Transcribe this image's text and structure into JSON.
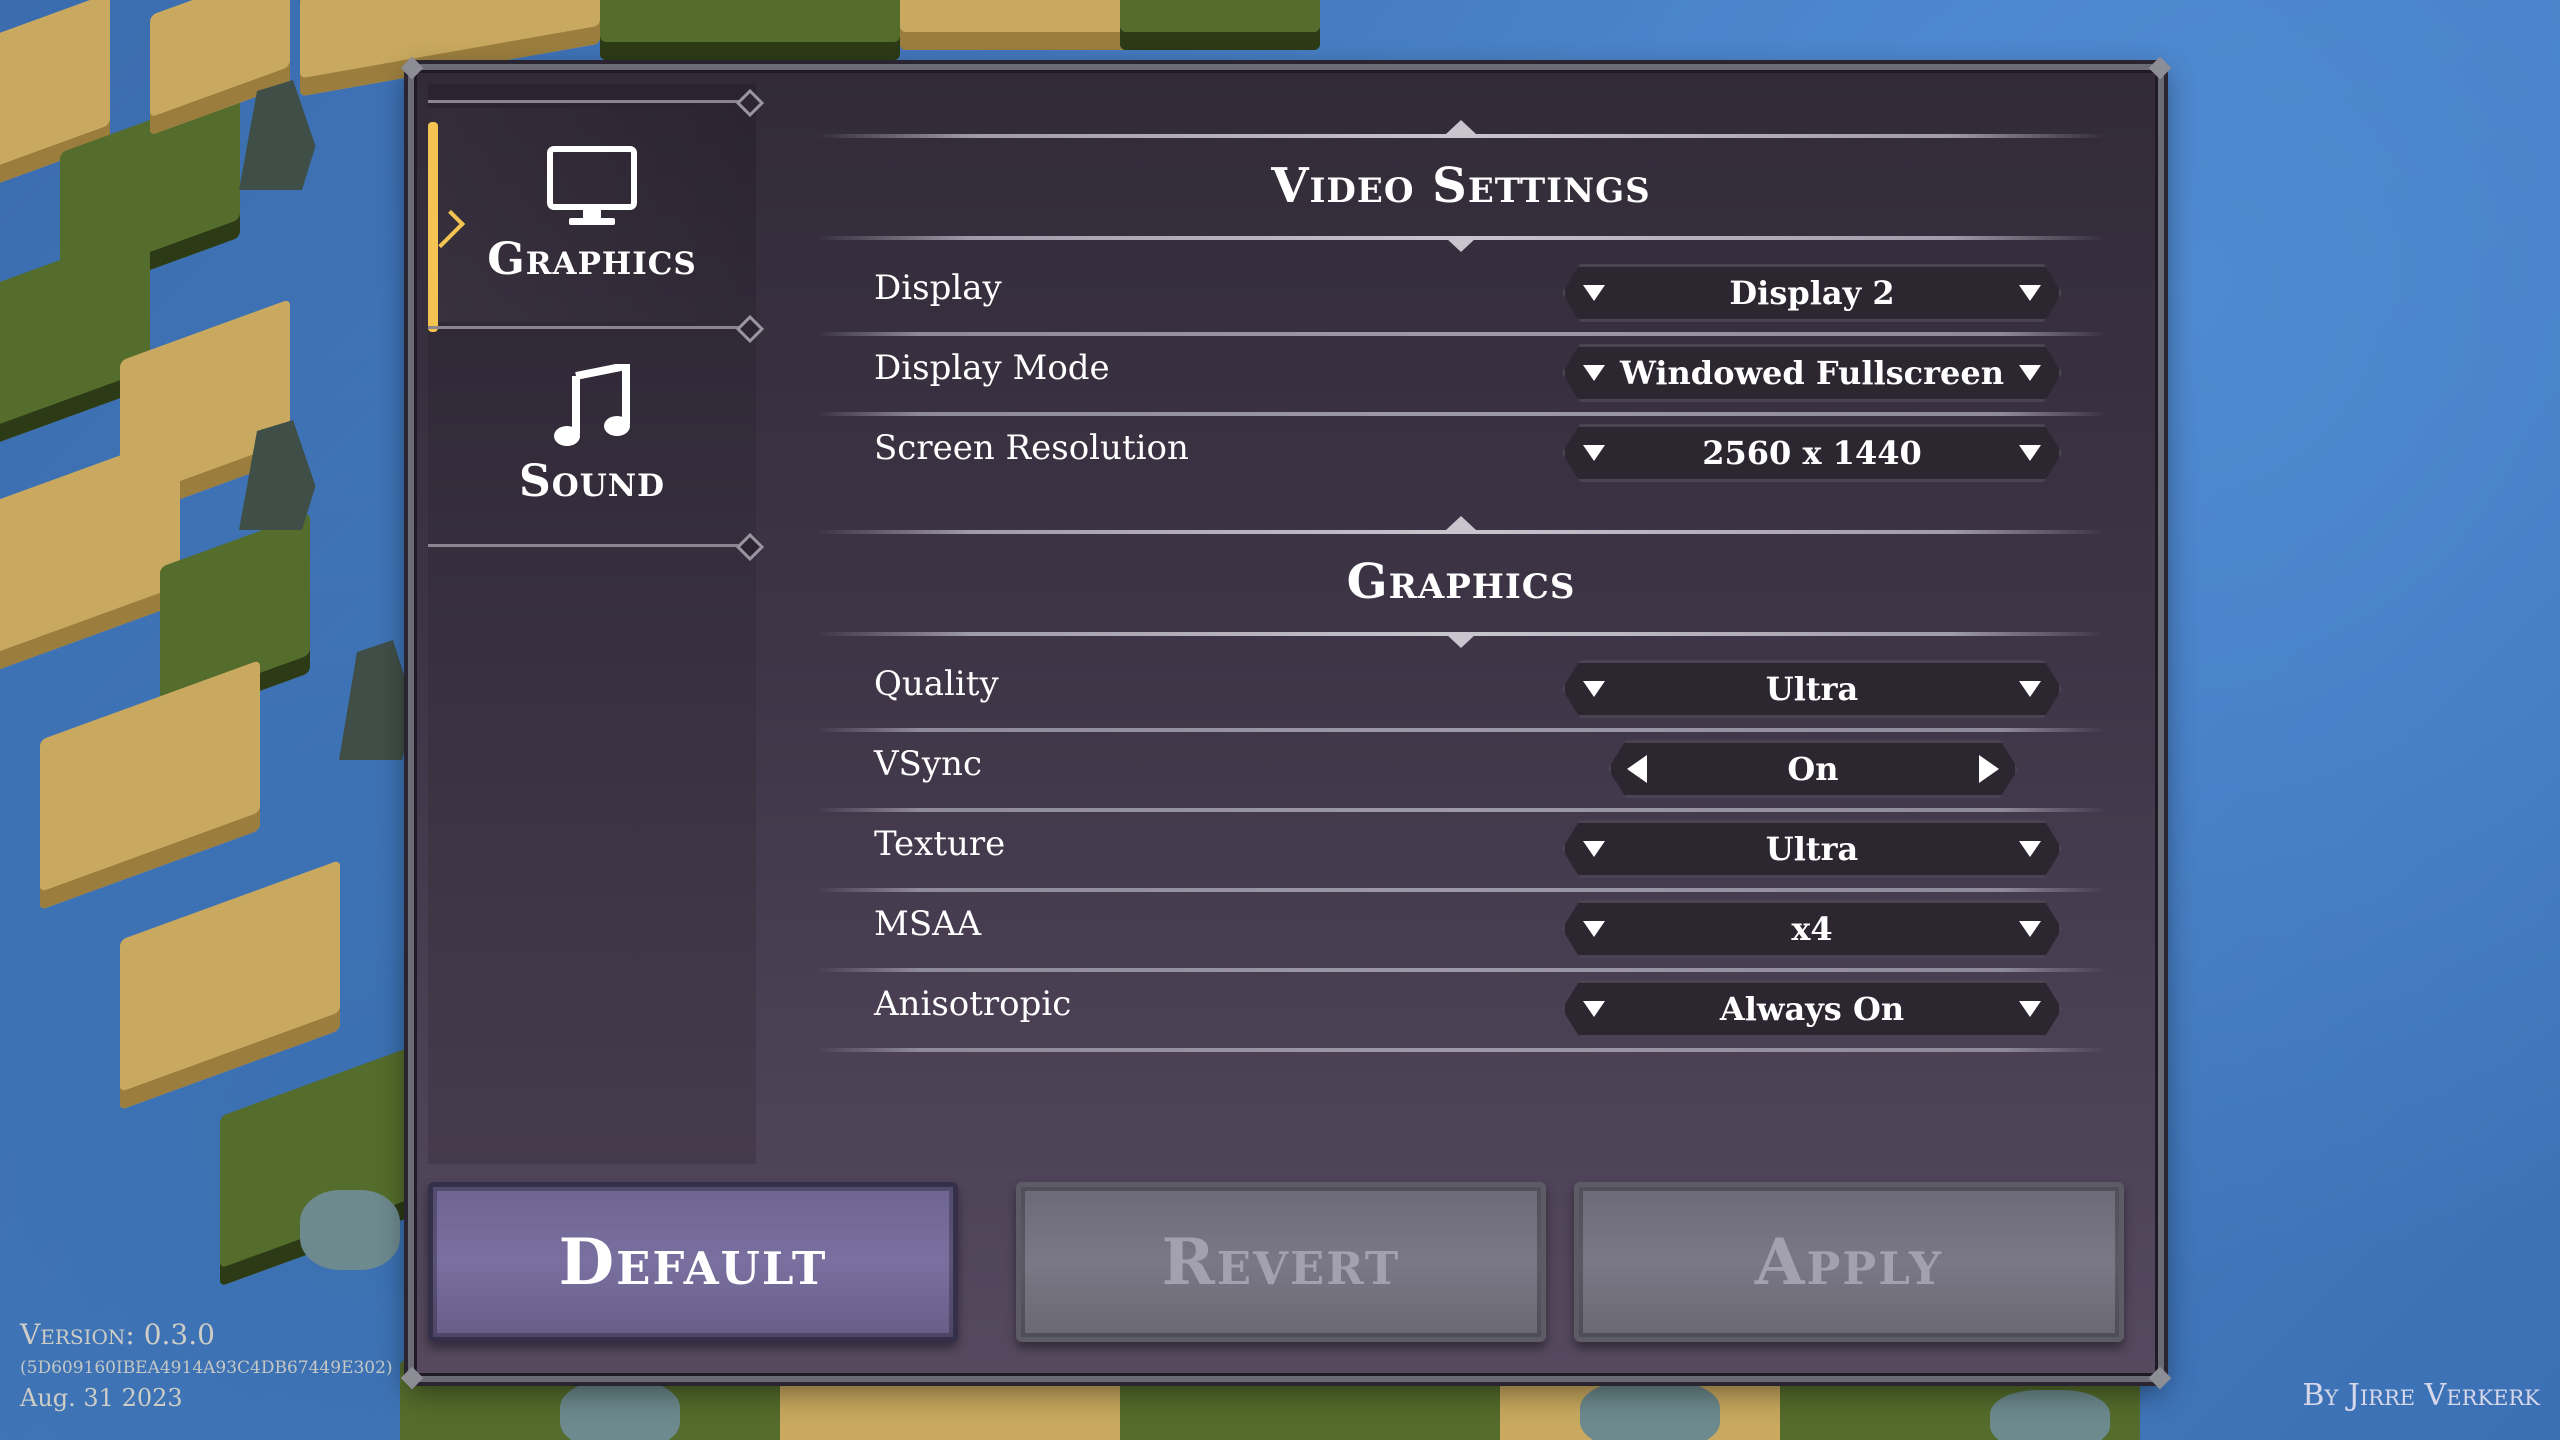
{
  "sidebar": {
    "tabs": [
      {
        "label": "Graphics",
        "icon": "monitor-icon",
        "active": true
      },
      {
        "label": "Sound",
        "icon": "music-note-icon",
        "active": false
      }
    ]
  },
  "video": {
    "title": "Video Settings",
    "rows": [
      {
        "label": "Display",
        "value": "Display 2"
      },
      {
        "label": "Display Mode",
        "value": "Windowed Fullscreen"
      },
      {
        "label": "Screen Resolution",
        "value": "2560 x 1440"
      }
    ]
  },
  "graphics": {
    "title": "Graphics",
    "rows": [
      {
        "label": "Quality",
        "value": "Ultra"
      },
      {
        "label": "VSync",
        "value": "On"
      },
      {
        "label": "Texture",
        "value": "Ultra"
      },
      {
        "label": "MSAA",
        "value": "x4"
      },
      {
        "label": "Anisotropic",
        "value": "Always On"
      }
    ]
  },
  "buttons": {
    "default": "Default",
    "revert": "Revert",
    "apply": "Apply"
  },
  "footer": {
    "version": "Version: 0.3.0",
    "hash": "(5D609160IBEA4914A93C4DB67449E302)",
    "date": "Aug. 31 2023",
    "credit": "By Jirre Verkerk"
  },
  "colors": {
    "accent": "#f3c24c",
    "primary_button": "#7a70a0",
    "disabled_button": "#7a7884",
    "panel": "#3e3547"
  }
}
